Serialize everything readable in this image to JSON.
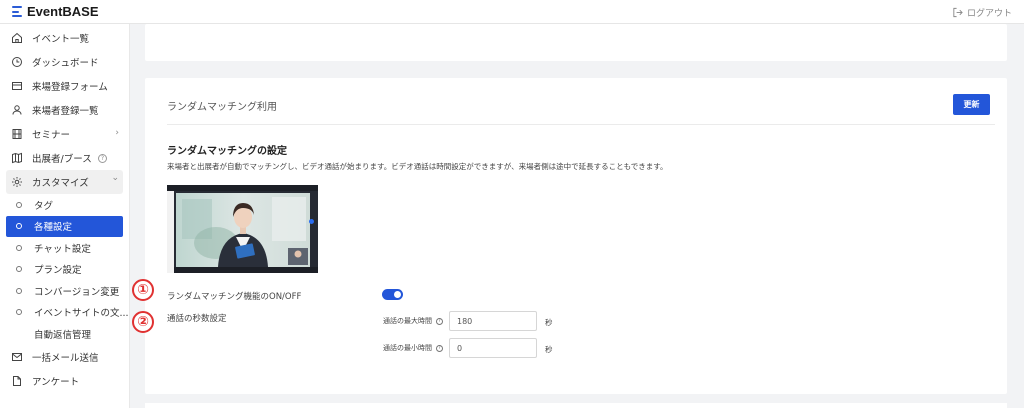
{
  "header": {
    "logo_text": "EventBASE",
    "logout_label": "ログアウト"
  },
  "sidebar": {
    "items": [
      {
        "label": "イベント一覧",
        "icon": "home-icon"
      },
      {
        "label": "ダッシュボード",
        "icon": "clock-icon"
      },
      {
        "label": "来場登録フォーム",
        "icon": "form-icon"
      },
      {
        "label": "来場者登録一覧",
        "icon": "user-icon"
      },
      {
        "label": "セミナー",
        "icon": "film-icon",
        "trail": "›"
      },
      {
        "label": "出展者/ブース",
        "icon": "map-icon",
        "trail": "?"
      },
      {
        "label": "カスタマイズ",
        "icon": "gear-icon",
        "trail": "⌄"
      }
    ],
    "sub_items": [
      {
        "label": "タグ"
      },
      {
        "label": "各種設定",
        "active": true
      },
      {
        "label": "チャット設定"
      },
      {
        "label": "プラン設定"
      },
      {
        "label": "コンバージョン変更"
      },
      {
        "label": "イベントサイトの文..."
      },
      {
        "label": "自動返信管理"
      }
    ],
    "bottom_items": [
      {
        "label": "一括メール送信",
        "icon": "mail-icon"
      },
      {
        "label": "アンケート",
        "icon": "document-icon"
      }
    ]
  },
  "main": {
    "card_title": "ランダムマッチング利用",
    "update_button": "更新",
    "section_title": "ランダムマッチングの設定",
    "section_desc": "来場者と出展者が自動でマッチングし、ビデオ通話が始まります。ビデオ通話は時間設定ができますが、来場者側は途中で延長することもできます。",
    "toggle_label": "ランダムマッチング機能のON/OFF",
    "toggle_on": true,
    "duration_label": "通話の秒数設定",
    "max_label": "通話の最大時間",
    "max_value": "180",
    "min_label": "通話の最小時間",
    "min_value": "0",
    "unit": "秒",
    "help_glyph": "?"
  },
  "badges": [
    "①",
    "②"
  ],
  "colors": {
    "accent": "#2356d9",
    "badge": "#e03131"
  }
}
